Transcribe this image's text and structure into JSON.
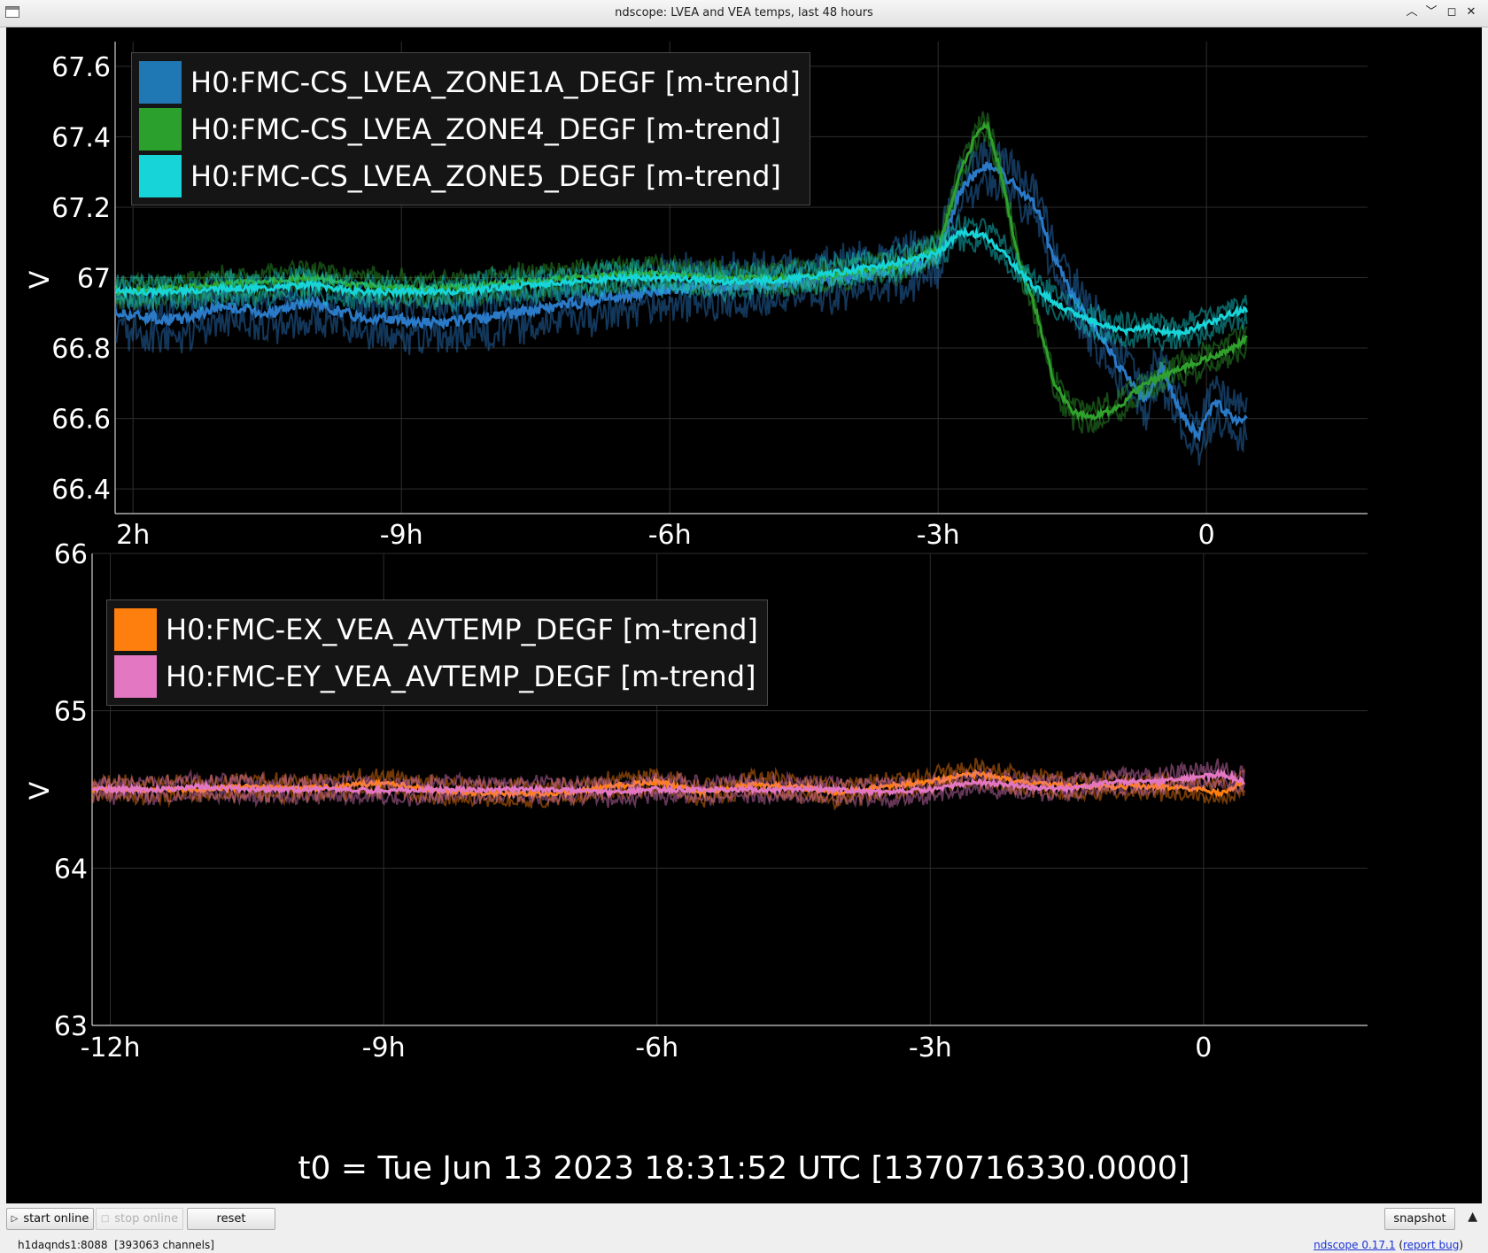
{
  "window": {
    "title": "ndscope: LVEA and VEA temps, last 48 hours",
    "controls": [
      "minimize",
      "maximize",
      "restore",
      "close"
    ]
  },
  "colors": {
    "zone1a": "#2a7ac8",
    "zone4": "#2fa12c",
    "zone5": "#17d4d8",
    "ex": "#ff7f0e",
    "ey": "#e377c2",
    "plot_bg": "#000000",
    "grid": "#2d2d2d",
    "axis_text": "#ffffff"
  },
  "plots": {
    "top": {
      "legend": [
        "H0:FMC-CS_LVEA_ZONE1A_DEGF [m-trend]",
        "H0:FMC-CS_LVEA_ZONE4_DEGF [m-trend]",
        "H0:FMC-CS_LVEA_ZONE5_DEGF [m-trend]"
      ],
      "ylabel": "V"
    },
    "bottom": {
      "legend": [
        "H0:FMC-EX_VEA_AVTEMP_DEGF [m-trend]",
        "H0:FMC-EY_VEA_AVTEMP_DEGF [m-trend]"
      ],
      "ylabel": "V"
    }
  },
  "t0_label": "t0 = Tue Jun 13 2023 18:31:52 UTC [1370716330.0000]",
  "buttons": {
    "start": "start online",
    "stop": "stop online",
    "reset": "reset",
    "snapshot": "snapshot"
  },
  "status": {
    "server": "h1daqnds1:8088",
    "channels": "[393063 channels]",
    "version_link": "ndscope 0.17.1",
    "report_link": "report bug"
  },
  "chart_data": [
    {
      "type": "line",
      "xlabel": "",
      "ylabel": "V",
      "xlim": [
        -12.2,
        1.8
      ],
      "ylim": [
        66.33,
        67.67
      ],
      "xticks": [
        -12,
        -9,
        -6,
        -3,
        0
      ],
      "xtick_labels": [
        "2h",
        "-9h",
        "-6h",
        "-3h",
        "0"
      ],
      "yticks": [
        66.4,
        66.6,
        66.8,
        67,
        67.2,
        67.4,
        67.6
      ],
      "ytick_labels": [
        "66.4",
        "66.6",
        "66.8",
        "67",
        "67.2",
        "67.4",
        "67.6"
      ],
      "grid": true,
      "legend_position": "top-left",
      "series": [
        {
          "name": "H0:FMC-CS_LVEA_ZONE1A_DEGF [m-trend]",
          "x": [
            -12.2,
            -11.5,
            -11,
            -10.5,
            -10,
            -9.5,
            -9,
            -8.5,
            -8,
            -7.5,
            -7,
            -6.5,
            -6,
            -5.5,
            -5,
            -4.5,
            -4,
            -3.5,
            -3,
            -2.75,
            -2.5,
            -2.3,
            -2.1,
            -1.9,
            -1.7,
            -1.5,
            -1.3,
            -1.1,
            -0.9,
            -0.7,
            -0.5,
            -0.3,
            -0.1,
            0.1,
            0.3,
            0.45
          ],
          "y": [
            66.9,
            66.88,
            66.92,
            66.9,
            66.93,
            66.89,
            66.88,
            66.87,
            66.89,
            66.91,
            66.93,
            66.95,
            66.97,
            66.97,
            66.98,
            66.99,
            67.0,
            67.02,
            67.05,
            67.25,
            67.32,
            67.3,
            67.25,
            67.2,
            67.05,
            66.95,
            66.88,
            66.8,
            66.72,
            66.65,
            66.75,
            66.62,
            66.55,
            66.65,
            66.6,
            66.6
          ]
        },
        {
          "name": "H0:FMC-CS_LVEA_ZONE4_DEGF [m-trend]",
          "x": [
            -12.2,
            -11.5,
            -11,
            -10.5,
            -10,
            -9.5,
            -9,
            -8.5,
            -8,
            -7.5,
            -7,
            -6.5,
            -6,
            -5.5,
            -5,
            -4.5,
            -4,
            -3.5,
            -3,
            -2.75,
            -2.55,
            -2.45,
            -2.3,
            -2.1,
            -1.9,
            -1.7,
            -1.5,
            -1.3,
            -1.1,
            -0.9,
            -0.7,
            -0.5,
            -0.3,
            -0.1,
            0.1,
            0.3,
            0.45
          ],
          "y": [
            66.96,
            66.97,
            66.98,
            66.99,
            67.0,
            66.98,
            66.97,
            66.97,
            66.98,
            66.99,
            67.0,
            67.01,
            67.01,
            67.0,
            67.0,
            67.0,
            67.01,
            67.03,
            67.08,
            67.3,
            67.42,
            67.43,
            67.3,
            67.05,
            66.9,
            66.7,
            66.62,
            66.6,
            66.62,
            66.65,
            66.7,
            66.72,
            66.74,
            66.76,
            66.78,
            66.8,
            66.83
          ]
        },
        {
          "name": "H0:FMC-CS_LVEA_ZONE5_DEGF [m-trend]",
          "x": [
            -12.2,
            -11.5,
            -11,
            -10.5,
            -10,
            -9.5,
            -9,
            -8.5,
            -8,
            -7.5,
            -7,
            -6.5,
            -6,
            -5.5,
            -5,
            -4.5,
            -4,
            -3.5,
            -3,
            -2.75,
            -2.5,
            -2.3,
            -2.1,
            -1.9,
            -1.7,
            -1.5,
            -1.3,
            -1.1,
            -0.9,
            -0.7,
            -0.5,
            -0.3,
            -0.1,
            0.1,
            0.3,
            0.45
          ],
          "y": [
            66.96,
            66.96,
            66.97,
            66.97,
            66.98,
            66.96,
            66.96,
            66.96,
            66.97,
            66.98,
            66.99,
            67.0,
            67.0,
            66.99,
            66.99,
            67.0,
            67.02,
            67.04,
            67.07,
            67.13,
            67.12,
            67.08,
            67.02,
            66.97,
            66.93,
            66.9,
            66.88,
            66.86,
            66.85,
            66.86,
            66.85,
            66.84,
            66.86,
            66.88,
            66.9,
            66.91
          ]
        }
      ]
    },
    {
      "type": "line",
      "xlabel": "",
      "ylabel": "V",
      "xlim": [
        -12.2,
        1.8
      ],
      "ylim": [
        63,
        66
      ],
      "xticks": [
        -12,
        -9,
        -6,
        -3,
        0
      ],
      "xtick_labels": [
        "-12h",
        "-9h",
        "-6h",
        "-3h",
        "0"
      ],
      "yticks": [
        63,
        64,
        65,
        66
      ],
      "ytick_labels": [
        "63",
        "64",
        "65",
        "66"
      ],
      "grid": true,
      "legend_position": "top-left",
      "series": [
        {
          "name": "H0:FMC-EX_VEA_AVTEMP_DEGF [m-trend]",
          "x": [
            -12.2,
            -11.5,
            -11,
            -10.5,
            -10,
            -9.5,
            -9,
            -8.5,
            -8,
            -7.5,
            -7,
            -6.5,
            -6,
            -5.5,
            -5,
            -4.5,
            -4,
            -3.5,
            -3,
            -2.5,
            -2,
            -1.5,
            -1,
            -0.5,
            0,
            0.2,
            0.45
          ],
          "y": [
            64.5,
            64.5,
            64.5,
            64.52,
            64.5,
            64.52,
            64.54,
            64.5,
            64.48,
            64.47,
            64.48,
            64.52,
            64.55,
            64.48,
            64.53,
            64.52,
            64.48,
            64.52,
            64.55,
            64.6,
            64.55,
            64.52,
            64.52,
            64.52,
            64.5,
            64.47,
            64.56
          ]
        },
        {
          "name": "H0:FMC-EY_VEA_AVTEMP_DEGF [m-trend]",
          "x": [
            -12.2,
            -11.5,
            -11,
            -10.5,
            -10,
            -9.5,
            -9,
            -8.5,
            -8,
            -7.5,
            -7,
            -6.5,
            -6,
            -5.5,
            -5,
            -4.5,
            -4,
            -3.5,
            -3,
            -2.5,
            -2,
            -1.5,
            -1,
            -0.5,
            0,
            0.2,
            0.45
          ],
          "y": [
            64.5,
            64.5,
            64.52,
            64.5,
            64.5,
            64.5,
            64.49,
            64.5,
            64.5,
            64.5,
            64.5,
            64.48,
            64.5,
            64.5,
            64.5,
            64.5,
            64.5,
            64.48,
            64.5,
            64.55,
            64.52,
            64.5,
            64.55,
            64.55,
            64.58,
            64.6,
            64.55
          ]
        }
      ]
    }
  ]
}
